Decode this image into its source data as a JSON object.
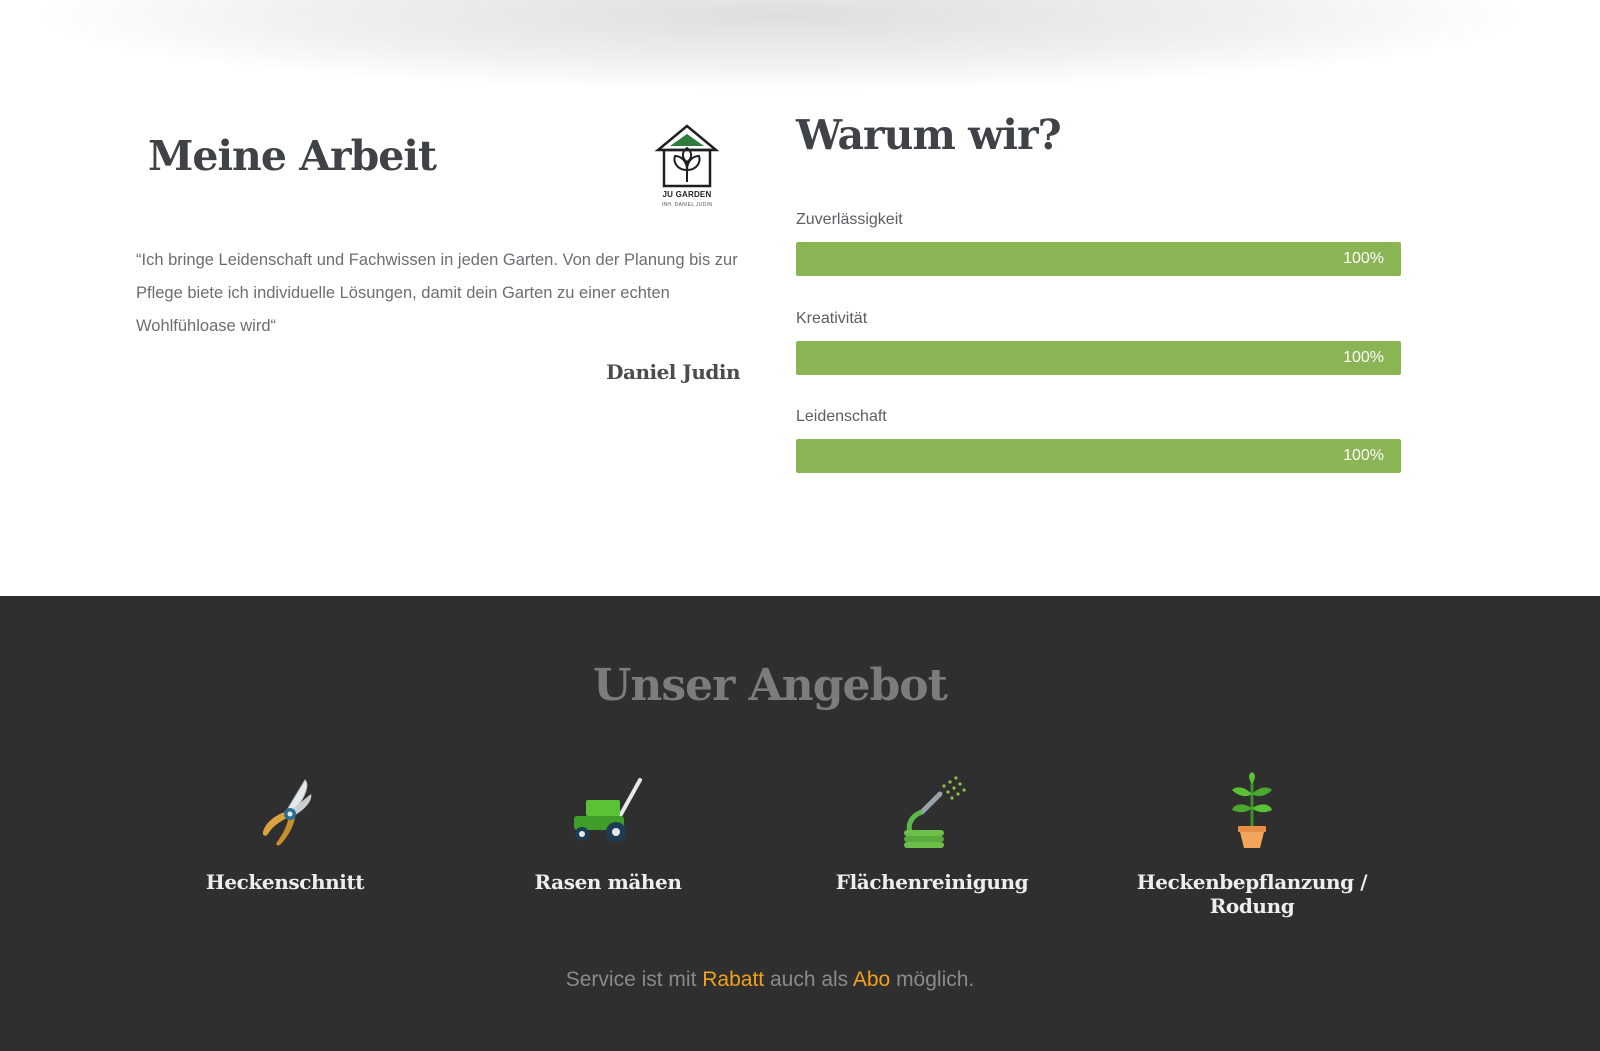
{
  "intro": {
    "title": "Meine Arbeit",
    "logo": {
      "brand": "JU GARDEN",
      "owner": "INH. DANIEL JUDIN",
      "icon": "house-plant-logo"
    },
    "quote": "“Ich bringe Leidenschaft und Fachwissen in jeden Garten. Von der Planung bis zur Pflege biete ich individuelle Lösungen, damit dein Garten zu einer echten Wohlfühloase wird“",
    "signature": "Daniel Judin"
  },
  "why": {
    "title": "Warum wir?",
    "skills": [
      {
        "label": "Zuverlässigkeit",
        "percent": 100,
        "value_text": "100%"
      },
      {
        "label": "Kreativität",
        "percent": 100,
        "value_text": "100%"
      },
      {
        "label": "Leidenschaft",
        "percent": 100,
        "value_text": "100%"
      }
    ]
  },
  "offer": {
    "title": "Unser Angebot",
    "services": [
      {
        "name": "Heckenschnitt",
        "icon": "pruning-shears-icon"
      },
      {
        "name": "Rasen mähen",
        "icon": "lawn-mower-icon"
      },
      {
        "name": "Flächenreinigung",
        "icon": "water-hose-icon"
      },
      {
        "name": "Heckenbepflanzung / Rodung",
        "icon": "potted-plant-icon"
      }
    ],
    "note": {
      "part1": "Service ist mit ",
      "highlight1": "Rabatt",
      "part2": " auch als ",
      "highlight2": "Abo",
      "part3": " möglich."
    }
  },
  "colors": {
    "progress_fill": "#8bb455",
    "dark_background": "#2f2f2f",
    "highlight": "#f2a11c",
    "heading": "#3f4246"
  }
}
